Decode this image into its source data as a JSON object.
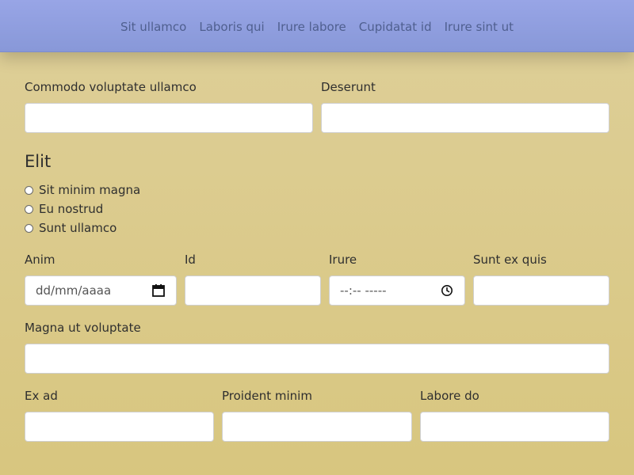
{
  "nav": {
    "items": [
      "Sit ullamco",
      "Laboris qui",
      "Irure labore",
      "Cupidatat id",
      "Irure sint ut"
    ]
  },
  "form": {
    "top_row": {
      "field1_label": "Commodo voluptate ullamco",
      "field2_label": "Deserunt"
    },
    "section_title": "Elit",
    "radio_options": [
      "Sit minim magna",
      "Eu nostrud",
      "Sunt ullamco"
    ],
    "middle_row": {
      "field1_label": "Anim",
      "field1_placeholder": "dd/mm/aaaa",
      "field2_label": "Id",
      "field3_label": "Irure",
      "field3_placeholder": "--:-- -----",
      "field4_label": "Sunt ex quis"
    },
    "wide_field": {
      "label": "Magna ut voluptate"
    },
    "bottom_row": {
      "field1_label": "Ex ad",
      "field2_label": "Proident minim",
      "field3_label": "Labore do"
    }
  },
  "icons": {
    "date_picker": "calendar-icon",
    "time_picker": "clock-icon"
  },
  "colors": {
    "background": "#dccb8d",
    "navbar": "#8f9de0",
    "nav_text": "#4f5f8f"
  }
}
